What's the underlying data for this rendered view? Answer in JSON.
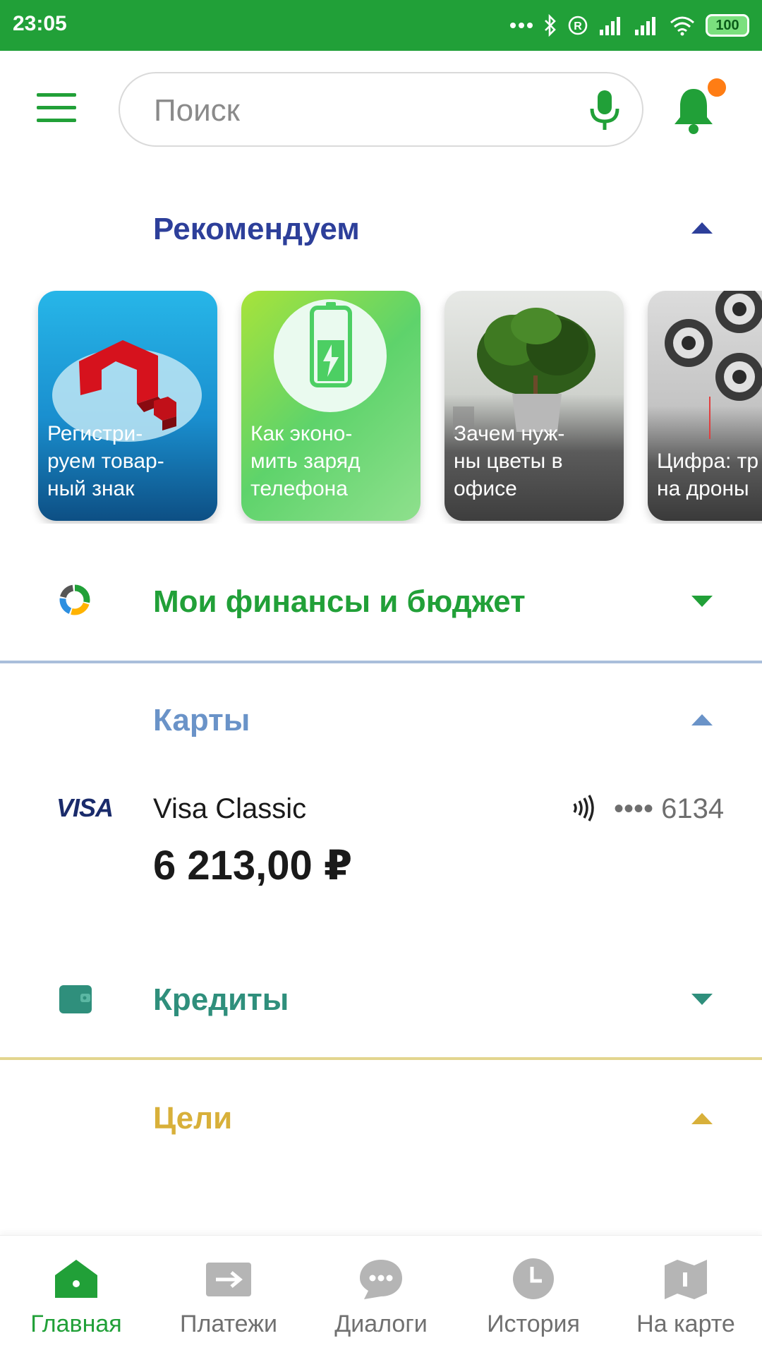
{
  "status_bar": {
    "time": "23:05",
    "battery": "100"
  },
  "search": {
    "placeholder": "Поиск"
  },
  "recommend": {
    "title": "Рекомендуем",
    "cards": [
      {
        "text": "Регистри-\nруем товар-\nный знак"
      },
      {
        "text": "Как эконо-\nмить заряд\nтелефона"
      },
      {
        "text": "Зачем нуж-\nны цветы в\nофисе"
      },
      {
        "text": "Цифра: тр\nна дроны"
      }
    ]
  },
  "finance": {
    "title": "Мои финансы и бюджет"
  },
  "cards_section": {
    "title": "Карты",
    "card": {
      "brand": "VISA",
      "name": "Visa Classic",
      "balance": "6 213,00 ₽",
      "number": "•••• 6134"
    }
  },
  "credits": {
    "title": "Кредиты"
  },
  "goals": {
    "title": "Цели"
  },
  "bottom_nav": [
    {
      "label": "Главная",
      "icon": "home-icon",
      "active": true
    },
    {
      "label": "Платежи",
      "icon": "payments-arrow-icon",
      "active": false
    },
    {
      "label": "Диалоги",
      "icon": "dialogs-bubble-icon",
      "active": false
    },
    {
      "label": "История",
      "icon": "history-clock-icon",
      "active": false
    },
    {
      "label": "На карте",
      "icon": "map-icon",
      "active": false
    }
  ],
  "colors": {
    "brand_green": "#21a038",
    "recommend_blue": "#2d3f9a",
    "cards_blue": "#6a93c8",
    "credits_teal": "#2f8f7c",
    "goals_gold": "#d8b03a",
    "notification_orange": "#ff7d14"
  }
}
